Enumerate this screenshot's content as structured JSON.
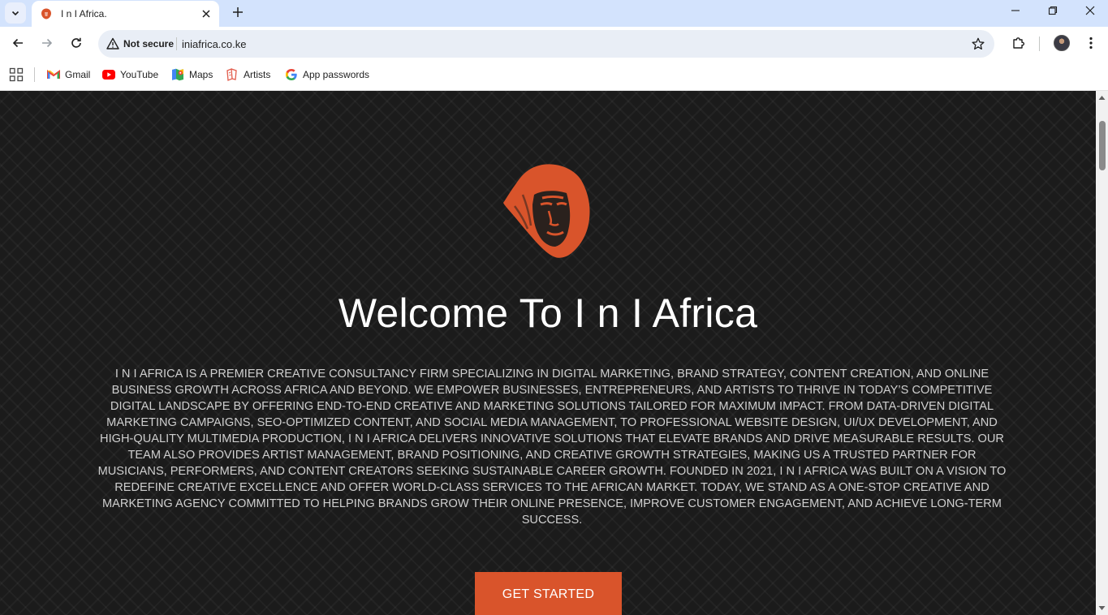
{
  "browser": {
    "tab": {
      "title": "I n I Africa."
    },
    "omnibox": {
      "security_label": "Not secure",
      "url": "iniafrica.co.ke"
    },
    "bookmarks": [
      {
        "label": "Gmail",
        "icon": "gmail-icon"
      },
      {
        "label": "YouTube",
        "icon": "youtube-icon"
      },
      {
        "label": "Maps",
        "icon": "maps-icon"
      },
      {
        "label": "Artists",
        "icon": "artists-icon"
      },
      {
        "label": "App passwords",
        "icon": "google-icon"
      }
    ]
  },
  "page": {
    "logo": "sphinx-logo-icon",
    "headline": "Welcome To I n I Africa",
    "intro": "I n I Africa is a premier creative consultancy firm specializing in digital marketing, brand strategy, content creation, and online business growth across Africa and beyond. We empower businesses, entrepreneurs, and artists to thrive in today’s competitive digital landscape by offering end-to-end creative and marketing solutions tailored for maximum impact. From data-driven digital marketing campaigns, SEO-optimized content, and social media management, to professional website design, UI/UX development, and high-quality multimedia production, I n I Africa delivers innovative solutions that elevate brands and drive measurable results. Our team also provides artist management, brand positioning, and creative growth strategies, making us a trusted partner for musicians, performers, and content creators seeking sustainable career growth. Founded in 2021, I n I Africa was built on a vision to redefine creative excellence and offer world-class services to the African market. Today, we stand as a one-stop creative and marketing agency committed to helping brands grow their online presence, improve customer engagement, and achieve long-term success.",
    "cta_label": "GET STARTED"
  },
  "colors": {
    "accent": "#d9542b",
    "page_background": "#1b1b1b",
    "tabstrip": "#d3e3fd"
  }
}
